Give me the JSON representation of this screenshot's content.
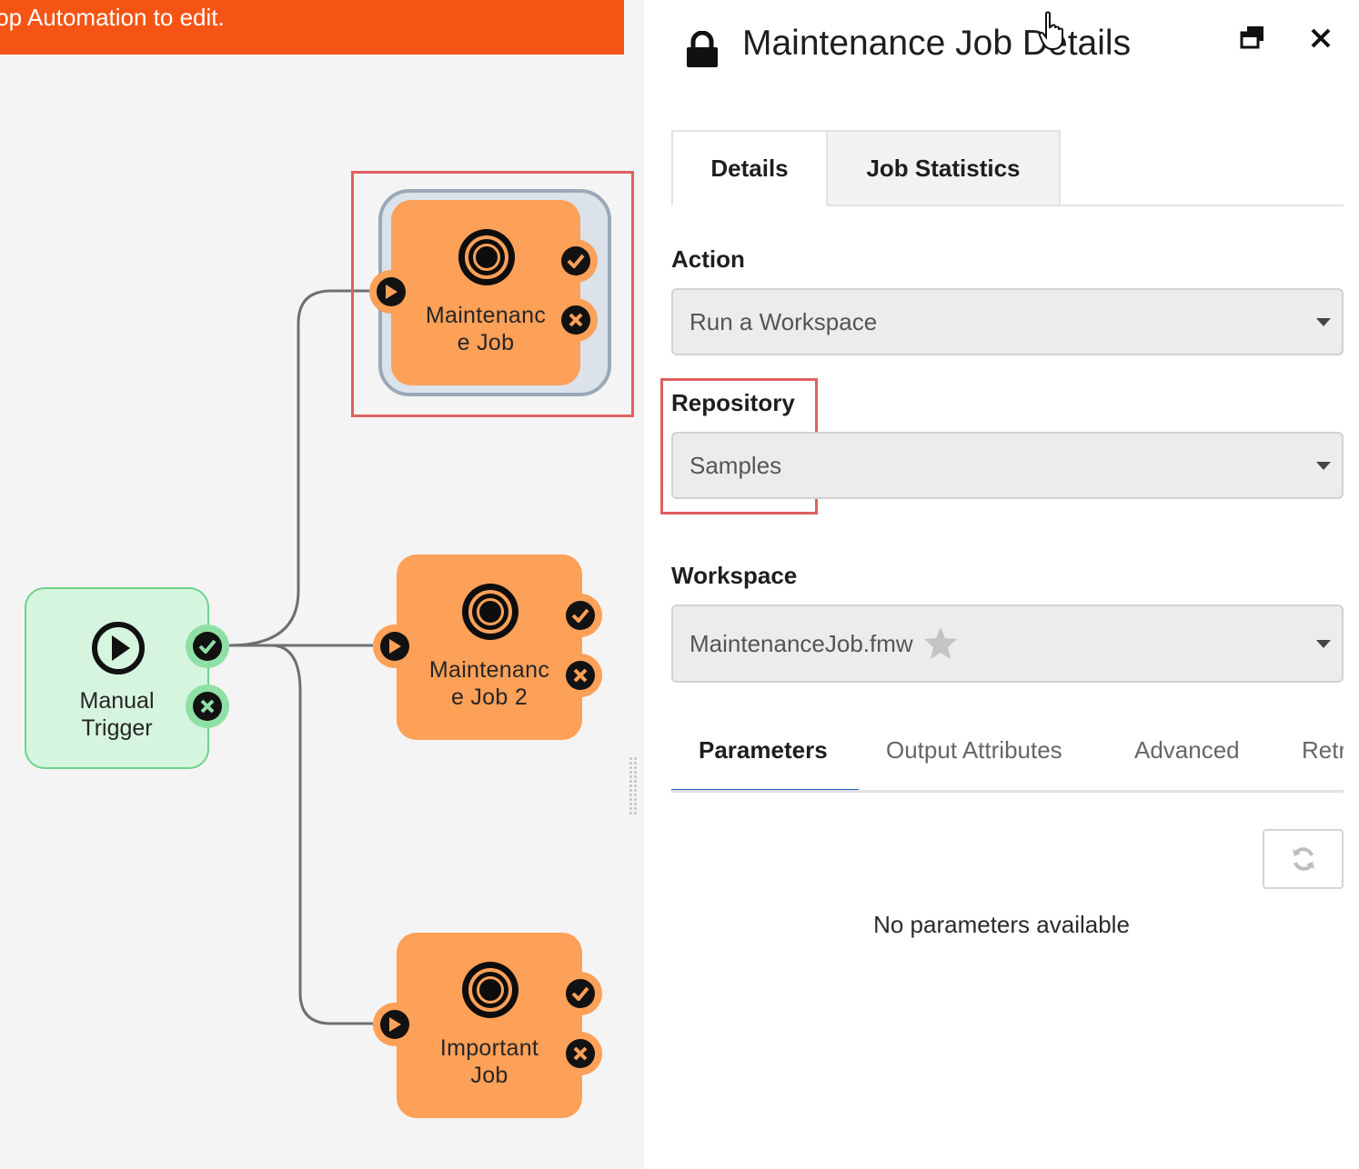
{
  "banner": {
    "text": "top Automation to edit."
  },
  "canvas": {
    "nodes": [
      {
        "name": "maintenance-job-node",
        "label": "Maintenanc\ne  Job",
        "color": "#fda058",
        "selected": true
      },
      {
        "name": "maintenance-job-2-node",
        "label": "Maintenanc\ne  Job 2",
        "color": "#fda058"
      },
      {
        "name": "important-job-node",
        "label": "Important\nJob",
        "color": "#fda058"
      }
    ],
    "trigger": {
      "label": "Manual\nTrigger",
      "color": "#d6f5de",
      "border": "#6bd48a"
    }
  },
  "panel": {
    "title": "Maintenance Job Details",
    "tabs": [
      {
        "label": "Details",
        "active": true
      },
      {
        "label": "Job Statistics",
        "active": false
      }
    ],
    "fields": {
      "action": {
        "label": "Action",
        "value": "Run a Workspace"
      },
      "repository": {
        "label": "Repository",
        "value": "Samples"
      },
      "workspace": {
        "label": "Workspace",
        "value": "MaintenanceJob.fmw"
      }
    },
    "subtabs": [
      {
        "label": "Parameters",
        "active": true
      },
      {
        "label": "Output Attributes",
        "active": false
      },
      {
        "label": "Advanced",
        "active": false
      },
      {
        "label": "Retr",
        "active": false
      }
    ],
    "empty_message": "No parameters available",
    "accent_color": "#1a5cc8"
  },
  "icons": [
    "lock-icon",
    "restore-window-icon",
    "close-icon",
    "hand-cursor-icon",
    "star-icon",
    "refresh-icon",
    "caret-down-icon",
    "play-icon",
    "check-icon",
    "x-icon",
    "target-icon"
  ]
}
